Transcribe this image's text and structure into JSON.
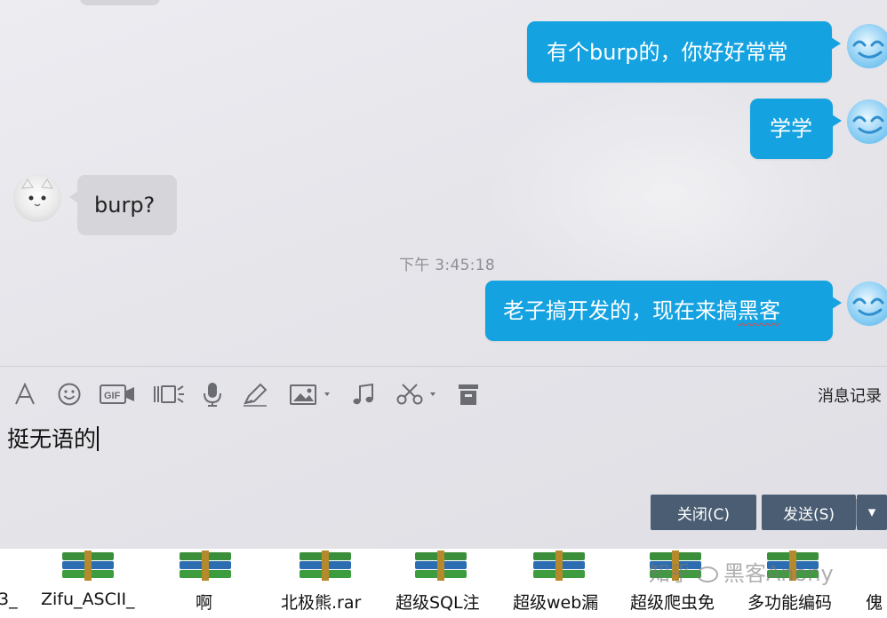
{
  "chat": {
    "messages": [
      {
        "side": "out",
        "text": "有个burp的，你好好常常"
      },
      {
        "side": "out",
        "text": "学学"
      },
      {
        "side": "in",
        "text": "burp?"
      },
      {
        "side": "out",
        "text_main": "老子搞开发的，现在来搞",
        "text_flag": "黑客"
      }
    ],
    "timestamp": "下午 3:45:18"
  },
  "toolbar": {
    "icons": [
      "font-icon",
      "emoji-icon",
      "gif-icon",
      "video-icon",
      "voice-icon",
      "pen-icon",
      "image-icon",
      "music-icon",
      "scissors-icon",
      "trash-icon"
    ],
    "history_label": "消息记录"
  },
  "input": {
    "value": "挺无语的"
  },
  "buttons": {
    "close_label": "关闭(C)",
    "send_label": "发送(S)",
    "send_menu_glyph": "▾"
  },
  "desktop": {
    "files": [
      {
        "label": "3_"
      },
      {
        "label": "Zifu_ASCII_"
      },
      {
        "label": "啊"
      },
      {
        "label": "北极熊.rar"
      },
      {
        "label": "超级SQL注"
      },
      {
        "label": "超级web漏"
      },
      {
        "label": "超级爬虫免"
      },
      {
        "label": "多功能编码"
      },
      {
        "label": "傀"
      }
    ]
  },
  "watermark": {
    "text_left": "知乎",
    "text_right": "黑客Anony"
  },
  "colors": {
    "bubble_out": "#15a2e0",
    "bubble_in": "#d5d5da",
    "button": "#4a5d73"
  }
}
